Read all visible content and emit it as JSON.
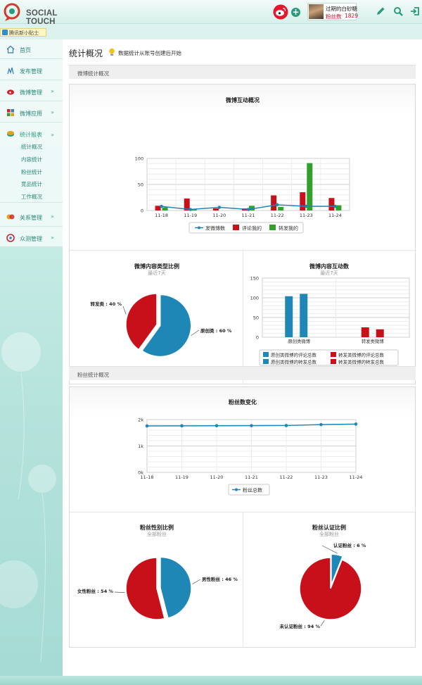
{
  "header": {
    "logo_text": "SOCIAL TOUCH",
    "user_name": "过期的白砂糖",
    "fans_label": "粉丝数",
    "fans_count": "1829"
  },
  "tip": {
    "text": "腾讯新小贴士"
  },
  "sidebar": {
    "items": [
      {
        "label": "首页",
        "icon": "home-icon",
        "arrow": ""
      },
      {
        "label": "发布管理",
        "icon": "publish-icon",
        "arrow": ""
      },
      {
        "label": "微博管理",
        "icon": "weibo-icon",
        "arrow": "»"
      },
      {
        "label": "微博应用",
        "icon": "apps-icon",
        "arrow": "»"
      },
      {
        "label": "统计报表",
        "icon": "report-icon",
        "arrow": "»"
      },
      {
        "label": "关系管理",
        "icon": "relation-icon",
        "arrow": "»"
      },
      {
        "label": "众测管理",
        "icon": "test-icon",
        "arrow": "»"
      }
    ],
    "sub_items": [
      "统计概况",
      "内容统计",
      "粉丝统计",
      "竞品统计",
      "工作概况"
    ]
  },
  "page": {
    "title": "统计概况",
    "note": "数据统计从账号创建后开始",
    "section1": "微博统计概况",
    "section2": "粉丝统计概况"
  },
  "colors": {
    "blue": "#1e87b5",
    "red": "#c8101a",
    "green": "#33a02c",
    "accent": "#2a8a7a"
  },
  "chart_data": [
    {
      "id": "weibo-interaction",
      "type": "bar",
      "title": "微博互动概况",
      "categories": [
        "11-18",
        "11-19",
        "11-20",
        "11-21",
        "11-22",
        "11-23",
        "11-24"
      ],
      "ylim": [
        0,
        100
      ],
      "yticks": [
        0,
        50,
        100
      ],
      "series": [
        {
          "name": "发微博数",
          "type": "line",
          "color": "#1e87b5",
          "values": [
            8,
            2,
            6,
            2,
            11,
            8,
            8
          ]
        },
        {
          "name": "评论我的",
          "type": "bar",
          "color": "#c8101a",
          "values": [
            9,
            23,
            4,
            4,
            29,
            35,
            24
          ]
        },
        {
          "name": "转发我的",
          "type": "bar",
          "color": "#33a02c",
          "values": [
            6,
            3,
            0,
            9,
            7,
            91,
            10
          ]
        }
      ]
    },
    {
      "id": "content-type-ratio",
      "type": "pie",
      "title": "微博内容类型比例",
      "subtitle": "最近7天",
      "slices": [
        {
          "name": "原创类",
          "value": 60,
          "label": "原创类 : 60 %",
          "color": "#1e87b5"
        },
        {
          "name": "转发类",
          "value": 40,
          "label": "转发类 : 40 %",
          "color": "#c8101a"
        }
      ]
    },
    {
      "id": "content-interaction",
      "type": "bar",
      "title": "微博内容互动数",
      "subtitle": "最近7天",
      "categories": [
        "原创类微博",
        "转发类微博"
      ],
      "ylim": [
        0,
        150
      ],
      "yticks": [
        0,
        50,
        100,
        150
      ],
      "series": [
        {
          "name": "原创类微博的评论总数",
          "color": "#1e87b5",
          "values": [
            104,
            0
          ]
        },
        {
          "name": "原创类微博的转发总数",
          "color": "#1e87b5",
          "values": [
            110,
            0
          ]
        },
        {
          "name": "转发类微博的评论总数",
          "color": "#c8101a",
          "values": [
            0,
            25
          ]
        },
        {
          "name": "转发类微博的转发总数",
          "color": "#c8101a",
          "values": [
            0,
            20
          ]
        }
      ]
    },
    {
      "id": "fans-change",
      "type": "line",
      "title": "粉丝数变化",
      "categories": [
        "11-18",
        "11-19",
        "11-20",
        "11-21",
        "11-22",
        "11-23",
        "11-24"
      ],
      "yticks": [
        "0k",
        "1k",
        "2k"
      ],
      "ylim": [
        0,
        2000
      ],
      "series": [
        {
          "name": "粉丝总数",
          "color": "#1e87b5",
          "values": [
            1760,
            1765,
            1768,
            1770,
            1775,
            1810,
            1829
          ]
        }
      ]
    },
    {
      "id": "fans-gender",
      "type": "pie",
      "title": "粉丝性别比例",
      "subtitle": "全部粉丝",
      "slices": [
        {
          "name": "男性粉丝",
          "value": 46,
          "label": "男性粉丝 : 46 %",
          "color": "#1e87b5"
        },
        {
          "name": "女性粉丝",
          "value": 54,
          "label": "女性粉丝 : 54 %",
          "color": "#c8101a"
        }
      ]
    },
    {
      "id": "fans-verified",
      "type": "pie",
      "title": "粉丝认证比例",
      "subtitle": "全部粉丝",
      "slices": [
        {
          "name": "认证粉丝",
          "value": 6,
          "label": "认证粉丝 : 6 %",
          "color": "#1e87b5"
        },
        {
          "name": "未认证粉丝",
          "value": 94,
          "label": "未认证粉丝 : 94 %",
          "color": "#c8101a"
        }
      ]
    }
  ]
}
